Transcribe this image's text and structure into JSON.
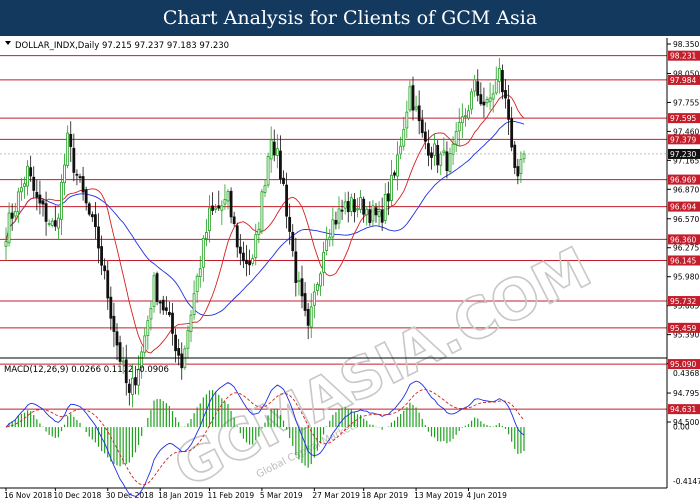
{
  "banner_title": "Chart Analysis for Clients of GCM Asia",
  "watermark_text": "GCMASIA.COM",
  "watermark_subtext": "Global Capital Markets",
  "chart_data": [
    {
      "type": "candlestick",
      "symbol_header": "DOLLAR_INDX,Daily  97.215 97.237 97.183 97.230",
      "ylim": [
        94.5,
        98.35
      ],
      "y_ticks": [
        98.35,
        98.05,
        97.755,
        97.46,
        97.165,
        96.87,
        96.57,
        96.275,
        95.98,
        95.685,
        95.39,
        95.095,
        94.795,
        94.5
      ],
      "y_tick_labels": [
        "98.350",
        "98.050",
        "97.755",
        "97.460",
        "97.165",
        "96.870",
        "96.570",
        "96.275",
        "95.980",
        "95.685",
        "95.390",
        "95.095",
        "94.795",
        "94.500"
      ],
      "x_tick_labels": [
        "16 Nov 2018",
        "10 Dec 2018",
        "30 Dec 2018",
        "18 Jan 2019",
        "11 Feb 2019",
        "5 Mar 2019",
        "27 Mar 2019",
        "18 Apr 2019",
        "13 May 2019",
        "4 Jun 2019"
      ],
      "current_price": 97.23,
      "current_price_label": "97.230",
      "levels": [
        98.231,
        97.984,
        97.595,
        97.379,
        96.969,
        96.694,
        96.36,
        96.145,
        95.732,
        95.459,
        95.09,
        94.631
      ],
      "level_labels": [
        "98.231",
        "97.984",
        "97.595",
        "97.379",
        "96.969",
        "96.694",
        "96.360",
        "96.145",
        "95.732",
        "95.459",
        "95.090",
        "94.631"
      ],
      "key_path": [
        [
          0,
          96.45
        ],
        [
          7,
          97.05
        ],
        [
          10,
          96.75
        ],
        [
          16,
          96.45
        ],
        [
          20,
          97.35
        ],
        [
          24,
          96.9
        ],
        [
          30,
          96.3
        ],
        [
          36,
          95.3
        ],
        [
          40,
          94.75
        ],
        [
          44,
          95.2
        ],
        [
          48,
          95.9
        ],
        [
          52,
          95.6
        ],
        [
          57,
          95.1
        ],
        [
          61,
          95.8
        ],
        [
          66,
          96.6
        ],
        [
          72,
          96.75
        ],
        [
          76,
          96.2
        ],
        [
          80,
          96.1
        ],
        [
          86,
          97.45
        ],
        [
          90,
          96.9
        ],
        [
          94,
          96.0
        ],
        [
          98,
          95.4
        ],
        [
          101,
          95.95
        ],
        [
          104,
          96.45
        ],
        [
          110,
          96.7
        ],
        [
          116,
          96.7
        ],
        [
          121,
          96.55
        ],
        [
          126,
          97.0
        ],
        [
          131,
          97.9
        ],
        [
          135,
          97.4
        ],
        [
          140,
          97.2
        ],
        [
          144,
          97.15
        ],
        [
          148,
          97.55
        ],
        [
          152,
          97.9
        ],
        [
          156,
          97.7
        ],
        [
          160,
          98.05
        ],
        [
          163,
          97.6
        ],
        [
          166,
          96.9
        ],
        [
          168,
          97.23
        ]
      ],
      "series": [
        {
          "name": "",
          "kind": "ma-fast",
          "color": "#d42020"
        },
        {
          "name": "",
          "kind": "ma-slow",
          "color": "#1e2ee6"
        }
      ],
      "up_color": "#1fa01f",
      "down_color": "#111111",
      "level_color": "#c41e2c"
    },
    {
      "type": "macd",
      "label": "MACD(12,26,9) 0.0266 0.1172 -0.0906",
      "ylim": [
        -0.4147,
        0.4368
      ],
      "y_tick_labels": [
        "0.4368",
        "0.00",
        "-0.4147"
      ],
      "macd_color": "#1e2ee6",
      "signal_color": "#d42020",
      "histogram_color": "#1fa01f"
    }
  ]
}
